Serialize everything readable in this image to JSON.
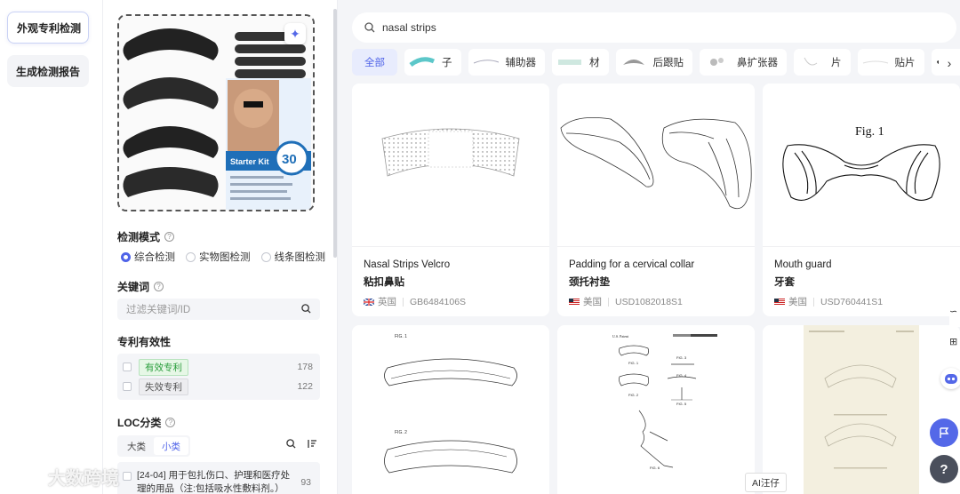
{
  "nav": {
    "items": [
      {
        "label": "外观专利检测",
        "active": true
      },
      {
        "label": "生成检测报告",
        "active": false
      }
    ]
  },
  "filters": {
    "mode": {
      "title": "检测模式",
      "options": [
        "综合检测",
        "实物图检测",
        "线条图检测"
      ],
      "selected": "综合检测"
    },
    "keyword": {
      "title": "关键词",
      "placeholder": "过滤关键词/ID"
    },
    "validity": {
      "title": "专利有效性",
      "items": [
        {
          "label": "有效专利",
          "count": "178"
        },
        {
          "label": "失效专利",
          "count": "122"
        }
      ]
    },
    "loc": {
      "title": "LOC分类",
      "tabs": [
        "大类",
        "小类"
      ],
      "active_tab": "小类",
      "items": [
        {
          "label": "[24-04] 用于包扎伤口、护理和医疗处理的用品（注:包括吸水性敷料剂。）",
          "count": "93"
        }
      ]
    }
  },
  "upload": {
    "badge_text": "Starter Kit",
    "badge_number": "30"
  },
  "search": {
    "query": "nasal strips"
  },
  "chips": [
    {
      "label": "全部",
      "active": true
    },
    {
      "label": "子"
    },
    {
      "label": "辅助器"
    },
    {
      "label": "材"
    },
    {
      "label": "后跟贴"
    },
    {
      "label": "鼻扩张器"
    },
    {
      "label": "片"
    },
    {
      "label": "贴片"
    },
    {
      "label": ""
    }
  ],
  "results": [
    {
      "title_en": "Nasal Strips Velcro",
      "title_zh": "粘扣鼻贴",
      "country": "英国",
      "id": "GB6484106S",
      "flag": "uk"
    },
    {
      "title_en": "Padding for a cervical collar",
      "title_zh": "颈托衬垫",
      "country": "美国",
      "id": "USD1082018S1",
      "flag": "us"
    },
    {
      "title_en": "Mouth guard",
      "title_zh": "牙套",
      "country": "美国",
      "id": "USD760441S1",
      "flag": "us",
      "fig_label": "Fig. 1"
    },
    {
      "fig_labels": [
        "FIG. 1",
        "FIG. 2"
      ]
    },
    {
      "header": "U.S. Patent",
      "fig_labels": [
        "FIG. 1",
        "FIG. 2",
        "FIG. 3",
        "FIG. 4",
        "FIG. 5",
        "FIG. 6"
      ]
    },
    {}
  ],
  "floating": {
    "ai_tip": "AI汪仔",
    "help": "?"
  },
  "watermark": "大数跨境"
}
